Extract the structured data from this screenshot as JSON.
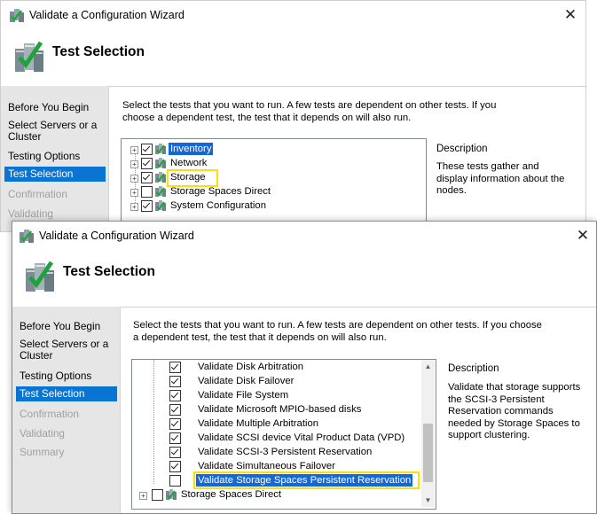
{
  "window1": {
    "title": "Validate a Configuration Wizard",
    "close_glyph": "✕",
    "header_title": "Test Selection",
    "nav": [
      {
        "label": "Before You Begin",
        "state": "normal"
      },
      {
        "label": "Select Servers or a Cluster",
        "state": "normal"
      },
      {
        "label": "Testing Options",
        "state": "normal"
      },
      {
        "label": "Test Selection",
        "state": "selected"
      },
      {
        "label": "Confirmation",
        "state": "disabled"
      },
      {
        "label": "Validating",
        "state": "disabled"
      }
    ],
    "intro": "Select the tests that you want to run.  A few tests are dependent on other tests.  If you choose a dependent test, the test that it depends on will also run.",
    "tree": [
      {
        "label": "Inventory",
        "checked": true,
        "highlighted": true
      },
      {
        "label": "Network",
        "checked": true,
        "highlighted": false
      },
      {
        "label": "Storage",
        "checked": true,
        "highlighted": false
      },
      {
        "label": "Storage Spaces Direct",
        "checked": false,
        "highlighted": false
      },
      {
        "label": "System Configuration",
        "checked": true,
        "highlighted": false
      }
    ],
    "description_heading": "Description",
    "description": "These tests gather and display information about the nodes."
  },
  "window2": {
    "title": "Validate a Configuration Wizard",
    "close_glyph": "✕",
    "header_title": "Test Selection",
    "nav": [
      {
        "label": "Before You Begin",
        "state": "normal"
      },
      {
        "label": "Select Servers or a Cluster",
        "state": "normal"
      },
      {
        "label": "Testing Options",
        "state": "normal"
      },
      {
        "label": "Test Selection",
        "state": "selected"
      },
      {
        "label": "Confirmation",
        "state": "disabled"
      },
      {
        "label": "Validating",
        "state": "disabled"
      },
      {
        "label": "Summary",
        "state": "disabled"
      }
    ],
    "intro": "Select the tests that you want to run.  A few tests are dependent on other tests.  If you choose a dependent test, the test that it depends on will also run.",
    "tree": [
      {
        "label": "Validate Disk Arbitration",
        "checked": true
      },
      {
        "label": "Validate Disk Failover",
        "checked": true
      },
      {
        "label": "Validate File System",
        "checked": true
      },
      {
        "label": "Validate Microsoft MPIO-based disks",
        "checked": true
      },
      {
        "label": "Validate Multiple Arbitration",
        "checked": true
      },
      {
        "label": "Validate SCSI device Vital Product Data (VPD)",
        "checked": true
      },
      {
        "label": "Validate SCSI-3 Persistent Reservation",
        "checked": true
      },
      {
        "label": "Validate Simultaneous Failover",
        "checked": true
      },
      {
        "label": "Validate Storage Spaces Persistent Reservation",
        "checked": false,
        "highlighted": true
      },
      {
        "label": "Storage Spaces Direct",
        "checked": false,
        "group": true
      }
    ],
    "scroll_up": "▲",
    "scroll_down": "▼",
    "description_heading": "Description",
    "description": "Validate that storage supports the SCSI-3 Persistent Reservation commands needed by Storage Spaces to support clustering."
  },
  "colors": {
    "selection_blue": "#0a74d3",
    "annotation_yellow": "#f5e10f",
    "sidebar_gray": "#e6e6e6"
  },
  "icons": [
    "cluster-wizard-icon",
    "test-category-icon",
    "close-icon",
    "expand-icon",
    "checkbox-icon",
    "scroll-up-arrow-icon",
    "scroll-down-arrow-icon"
  ]
}
